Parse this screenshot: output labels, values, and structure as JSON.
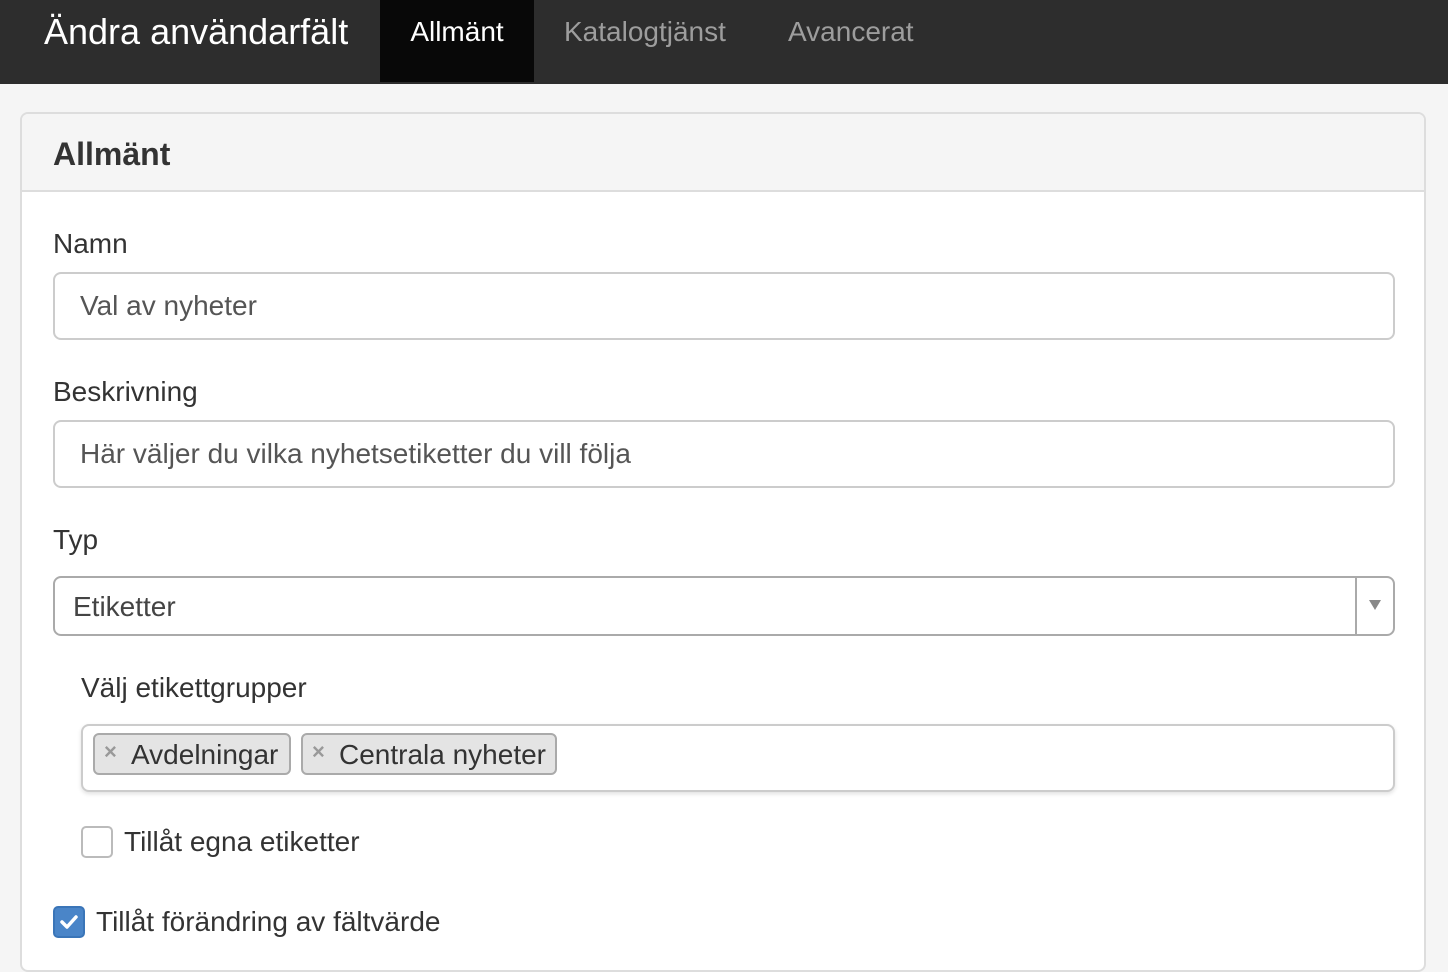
{
  "header": {
    "title": "Ändra användarfält",
    "tabs": [
      {
        "label": "Allmänt",
        "active": true
      },
      {
        "label": "Katalogtjänst",
        "active": false
      },
      {
        "label": "Avancerat",
        "active": false
      }
    ]
  },
  "panel": {
    "title": "Allmänt",
    "fields": {
      "name": {
        "label": "Namn",
        "value": "Val av nyheter"
      },
      "description": {
        "label": "Beskrivning",
        "value": "Här väljer du vilka nyhetsetiketter du vill följa"
      },
      "type": {
        "label": "Typ",
        "value": "Etiketter"
      }
    },
    "tag_groups": {
      "label": "Välj etikettgrupper",
      "selected": [
        "Avdelningar",
        "Centrala nyheter"
      ]
    },
    "checkboxes": {
      "allow_own_tags": {
        "label": "Tillåt egna etiketter",
        "checked": false
      },
      "allow_change": {
        "label": "Tillåt förändring av fältvärde",
        "checked": true
      }
    }
  },
  "colors": {
    "topbar": "#2d2d2d",
    "active_tab": "#080808",
    "checkbox_checked": "#4a85c8"
  },
  "icons": {
    "chip_remove": "close-icon",
    "select_arrow": "chevron-down-icon",
    "checkbox_checked": "check-icon"
  }
}
